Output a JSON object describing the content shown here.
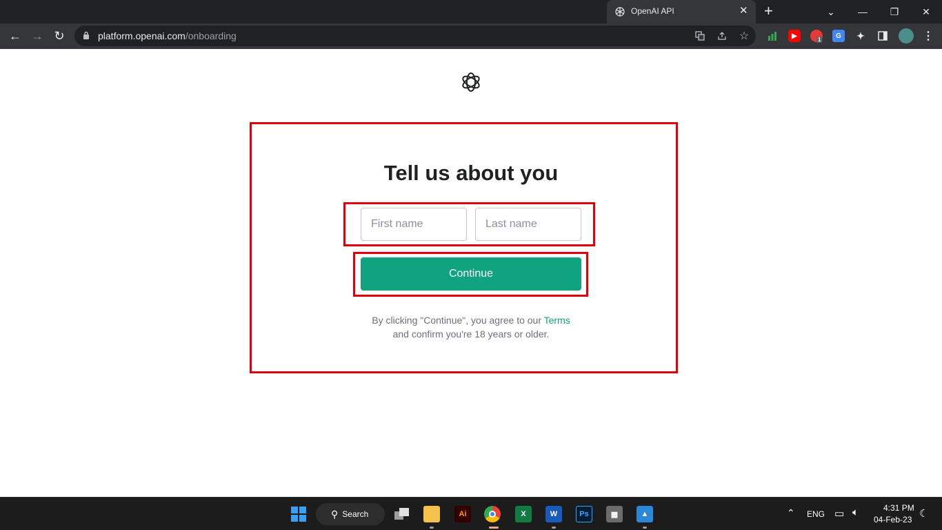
{
  "browser": {
    "tab_title": "OpenAI API",
    "tab_close": "✕",
    "new_tab": "+",
    "url_domain": "platform.openai.com",
    "url_path": "/onboarding",
    "window_controls": {
      "minimize": "—",
      "maximize": "❐",
      "close": "✕",
      "tab_search": "⌄"
    }
  },
  "page": {
    "heading": "Tell us about you",
    "first_name_placeholder": "First name",
    "last_name_placeholder": "Last name",
    "continue_label": "Continue",
    "terms_prefix": "By clicking \"Continue\", you agree to our ",
    "terms_link": "Terms",
    "terms_suffix": "and confirm you're 18 years or older.",
    "accent_color": "#10a37f",
    "highlight_color": "#e0000b"
  },
  "taskbar": {
    "search_label": "Search",
    "language": "ENG",
    "time": "4:31 PM",
    "date": "04-Feb-23",
    "extension_badge": "1"
  }
}
